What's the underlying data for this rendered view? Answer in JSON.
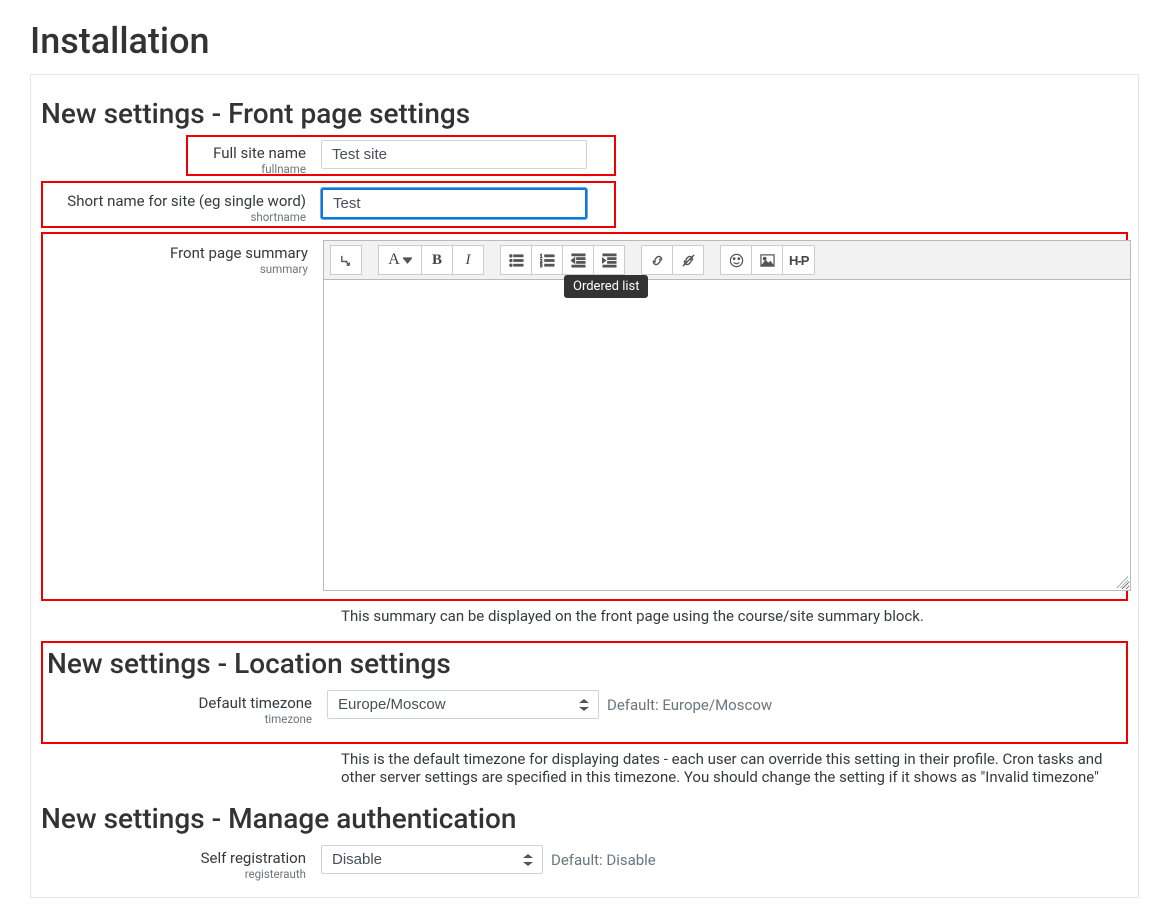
{
  "page": {
    "title": "Installation"
  },
  "frontpage": {
    "heading": "New settings - Front page settings",
    "fullname": {
      "label": "Full site name",
      "sub": "fullname",
      "value": "Test site"
    },
    "shortname": {
      "label": "Short name for site (eg single word)",
      "sub": "shortname",
      "value": "Test"
    },
    "summary": {
      "label": "Front page summary",
      "sub": "summary",
      "desc": "This summary can be displayed on the front page using the course/site summary block."
    },
    "tooltip": "Ordered list",
    "toolbar": {
      "expand": "↴",
      "font": "A",
      "bold": "B",
      "italic": "I",
      "h5p": "H-P"
    }
  },
  "location": {
    "heading": "New settings - Location settings",
    "timezone": {
      "label": "Default timezone",
      "sub": "timezone",
      "value": "Europe/Moscow",
      "default": "Default: Europe/Moscow",
      "desc": "This is the default timezone for displaying dates - each user can override this setting in their profile. Cron tasks and other server settings are specified in this timezone. You should change the setting if it shows as \"Invalid timezone\""
    }
  },
  "auth": {
    "heading": "New settings - Manage authentication",
    "selfreg": {
      "label": "Self registration",
      "sub": "registerauth",
      "value": "Disable",
      "default": "Default: Disable"
    }
  }
}
